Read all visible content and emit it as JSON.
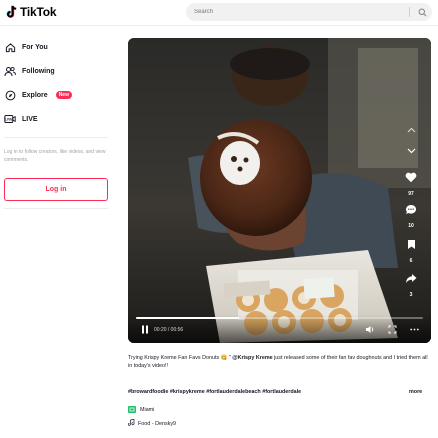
{
  "app": {
    "brand": "TikTok",
    "accent": "#fe2c55"
  },
  "search": {
    "placeholder": "Search"
  },
  "sidebar": {
    "items": [
      {
        "label": "For You",
        "icon": "home-icon"
      },
      {
        "label": "Following",
        "icon": "following-icon"
      },
      {
        "label": "Explore",
        "icon": "compass-icon",
        "badge": "New"
      },
      {
        "label": "LIVE",
        "icon": "live-icon"
      }
    ],
    "login_hint": "Log in to follow creators, like videos, and view comments.",
    "login_label": "Log in"
  },
  "video": {
    "time": "00:20 / 00:56",
    "progress": 0.36
  },
  "actions": [
    {
      "icon": "heart-icon",
      "count": "97"
    },
    {
      "icon": "comment-icon",
      "count": "10"
    },
    {
      "icon": "bookmark-icon",
      "count": "6"
    },
    {
      "icon": "share-icon",
      "count": "3"
    }
  ],
  "caption": {
    "text_start": "Trying Krispy Kreme Fan Favs Donuts 😋 \" ",
    "mention": "@Krispy Kreme",
    "text_end": " just released some of their fan fav doughnuts and I tried them all in today's video!!",
    "hashtags": "#browardfoodie #krispykreme #fortlauderdalebeach #fortlauderdale",
    "more": "more",
    "location": "Miami",
    "music": "Food - Densky9"
  }
}
